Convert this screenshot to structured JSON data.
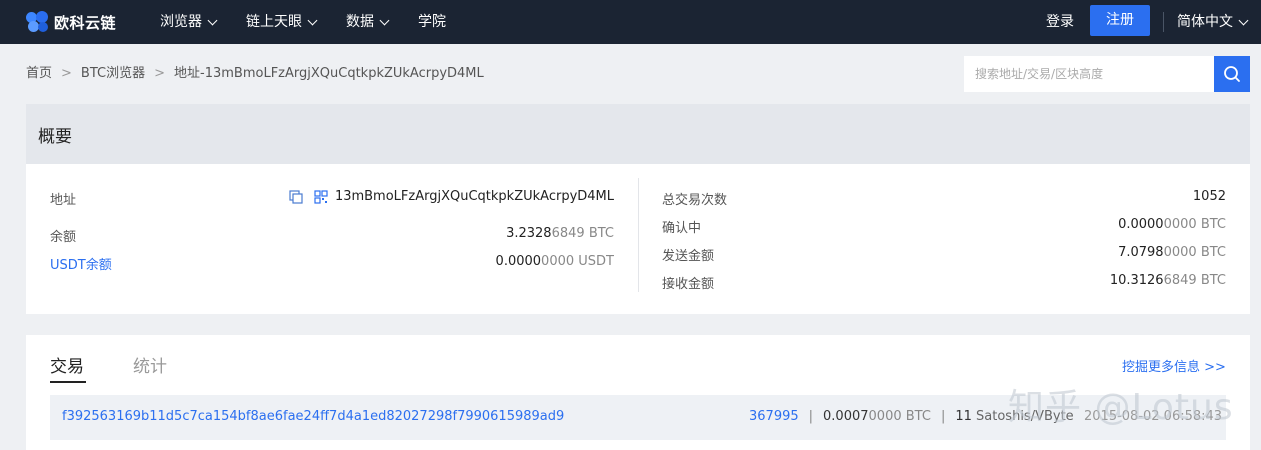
{
  "brand": {
    "name": "欧科云链"
  },
  "nav": {
    "items": [
      {
        "label": "浏览器"
      },
      {
        "label": "链上天眼"
      },
      {
        "label": "数据"
      },
      {
        "label": "学院"
      }
    ],
    "login": "登录",
    "register": "注册",
    "language": "简体中文"
  },
  "breadcrumb": {
    "home": "首页",
    "explorer": "BTC浏览器",
    "current": "地址-13mBmoLFzArgjXQuCqtkpkZUkAcrpyD4ML"
  },
  "search": {
    "placeholder": "搜索地址/交易/区块高度"
  },
  "overview": {
    "title": "概要",
    "address_label": "地址",
    "address_value": "13mBmoLFzArgjXQuCqtkpkZUkAcrpyD4ML",
    "balance_label": "余额",
    "balance_main": "3.2328",
    "balance_rest": "6849",
    "balance_unit": "BTC",
    "usdt_label": "USDT余额",
    "usdt_main": "0.0000",
    "usdt_rest": "0000",
    "usdt_unit": "USDT",
    "tx_count_label": "总交易次数",
    "tx_count_value": "1052",
    "pending_label": "确认中",
    "pending_main": "0.0000",
    "pending_rest": "0000",
    "pending_unit": "BTC",
    "sent_label": "发送金额",
    "sent_main": "7.0798",
    "sent_rest": "0000",
    "sent_unit": "BTC",
    "received_label": "接收金额",
    "received_main": "10.3126",
    "received_rest": "6849",
    "received_unit": "BTC"
  },
  "tabs": {
    "transactions": "交易",
    "statistics": "统计",
    "more_info": "挖掘更多信息 >>"
  },
  "transactions": [
    {
      "hash": "f392563169b11d5c7ca154bf8ae6fae24ff7d4a1ed82027298f7990615989ad9",
      "block": "367995",
      "amount_main": "0.0007",
      "amount_rest": "0000",
      "amount_unit": "BTC",
      "fee_rate_value": "11",
      "fee_rate_unit": "Satoshis/VByte",
      "time": "2015-08-02 06:58:43"
    }
  ],
  "watermark": "知乎 @Lotus",
  "colors": {
    "nav_bg": "#1b2433",
    "accent": "#2b6ff0",
    "page_bg": "#eef0f3"
  },
  "icons": [
    "copy-icon",
    "qrcode-icon",
    "search-icon",
    "chevron-down-icon"
  ]
}
